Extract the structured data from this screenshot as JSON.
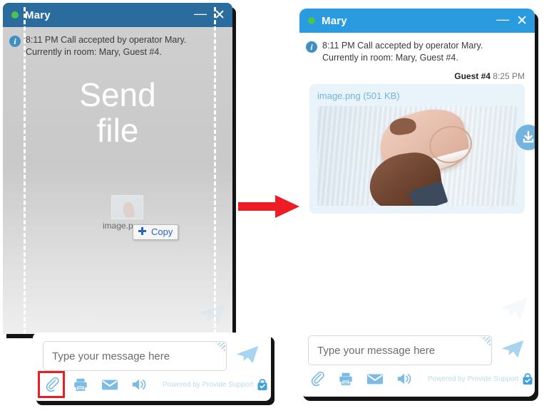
{
  "left_window": {
    "title": "Mary",
    "status_icon": "online-status-dot",
    "minimize_label": "—",
    "close_label": "✕",
    "system_message": {
      "icon": "info-icon",
      "line1": "8:11 PM  Call accepted by operator Mary.",
      "line2": "Currently in room: Mary, Guest #4."
    },
    "drop_zone": {
      "label_line1": "Send",
      "label_line2": "file",
      "dragged_file_name": "image.p",
      "copy_tooltip": "Copy",
      "plus_icon": "plus-icon"
    },
    "composer": {
      "placeholder": "Type your message here",
      "send_icon": "send-plane-icon"
    },
    "toolbar": {
      "attach_icon": "paperclip-icon",
      "print_icon": "printer-icon",
      "email_icon": "envelope-icon",
      "sound_icon": "speaker-icon",
      "brand_text": "Powered by Provide Support",
      "brand_icon": "lock-badge-icon",
      "highlight_color": "#ec1c24"
    }
  },
  "right_window": {
    "title": "Mary",
    "status_icon": "online-status-dot",
    "minimize_label": "—",
    "close_label": "✕",
    "system_message": {
      "icon": "info-icon",
      "line1": "8:11 PM  Call accepted by operator Mary.",
      "line2": "Currently in room: Mary, Guest #4."
    },
    "message": {
      "sender": "Guest #4",
      "time": "8:25 PM",
      "attachment_name": "image.png (501 KB)",
      "attachment_preview": "sneaker-in-hand-photo",
      "download_icon": "download-icon"
    },
    "composer": {
      "placeholder": "Type your message here",
      "send_icon": "send-plane-icon"
    },
    "toolbar": {
      "attach_icon": "paperclip-icon",
      "print_icon": "printer-icon",
      "email_icon": "envelope-icon",
      "sound_icon": "speaker-icon",
      "brand_text": "Powered by Provide Support",
      "brand_icon": "lock-badge-icon"
    }
  },
  "annotation": {
    "arrow_icon": "right-arrow",
    "arrow_color": "#ee1c25"
  },
  "colors": {
    "left_header_blue": "#2b6c9e",
    "right_header_blue": "#2b9be0",
    "bubble_blue": "#e8f3fa",
    "accent_blue": "#74b3dd",
    "status_green": "#4ec24e"
  }
}
